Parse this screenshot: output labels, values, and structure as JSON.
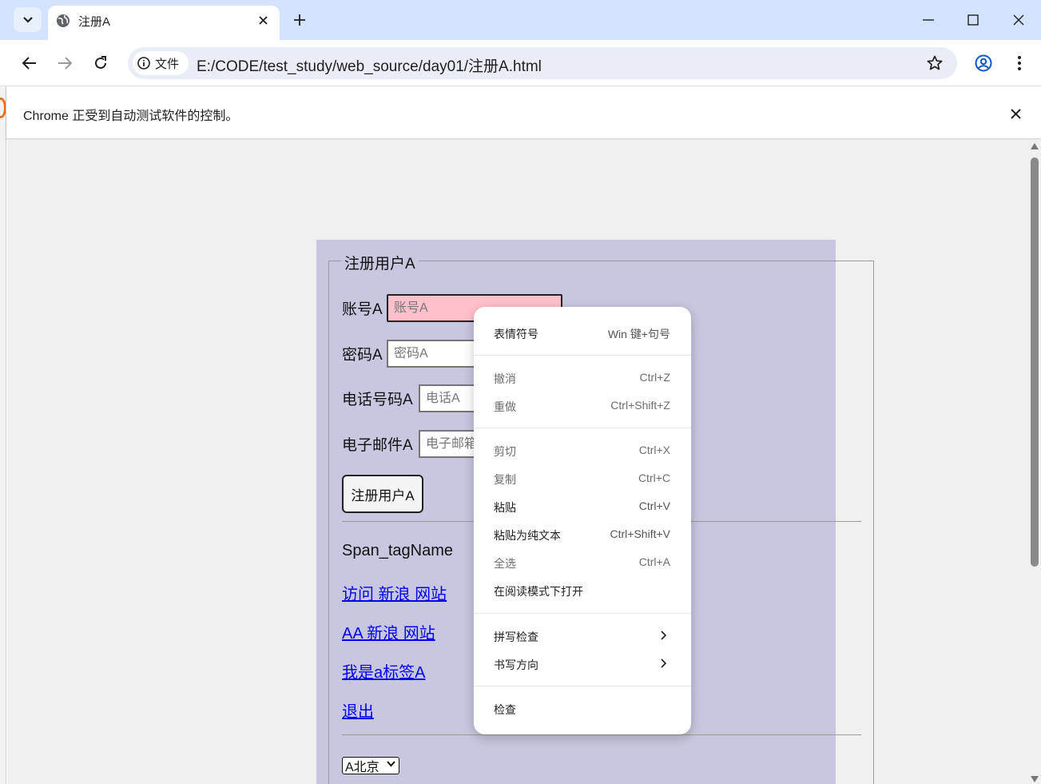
{
  "browser": {
    "tab_title": "注册A",
    "url_chip_label": "文件",
    "url": "E:/CODE/test_study/web_source/day01/注册A.html",
    "infobar_text": "Chrome 正受到自动测试软件的控制。"
  },
  "page": {
    "legend": "注册用户A",
    "fields": [
      {
        "label": "账号A",
        "placeholder": "账号A"
      },
      {
        "label": "密码A",
        "placeholder": "密码A"
      },
      {
        "label": "电话号码A",
        "placeholder": "电话A"
      },
      {
        "label": "电子邮件A",
        "placeholder": "电子邮箱"
      }
    ],
    "submit_label": "注册用户A",
    "span_text": "Span_tagName",
    "links": [
      "访问 新浪 网站",
      "AA 新浪 网站",
      "我是a标签A",
      "退出"
    ],
    "select_value": "A北京"
  },
  "context_menu": {
    "items": [
      {
        "label": "表情符号",
        "shortcut": "Win 键+句号"
      },
      {
        "label": "撤消",
        "shortcut": "Ctrl+Z",
        "disabled": true
      },
      {
        "label": "重做",
        "shortcut": "Ctrl+Shift+Z",
        "disabled": true
      },
      {
        "label": "剪切",
        "shortcut": "Ctrl+X",
        "disabled": true
      },
      {
        "label": "复制",
        "shortcut": "Ctrl+C",
        "disabled": true
      },
      {
        "label": "粘贴",
        "shortcut": "Ctrl+V"
      },
      {
        "label": "粘贴为纯文本",
        "shortcut": "Ctrl+Shift+V"
      },
      {
        "label": "全选",
        "shortcut": "Ctrl+A",
        "disabled": true
      },
      {
        "label": "在阅读模式下打开",
        "shortcut": ""
      },
      {
        "label": "拼写检查",
        "submenu": true
      },
      {
        "label": "书写方向",
        "submenu": true
      },
      {
        "label": "检查",
        "shortcut": ""
      }
    ]
  },
  "colors": {
    "tabstrip": "#d3e3fd",
    "form_background": "#c8c6e0",
    "focused_input": "#ffc0cb",
    "link": "#0000ee"
  }
}
